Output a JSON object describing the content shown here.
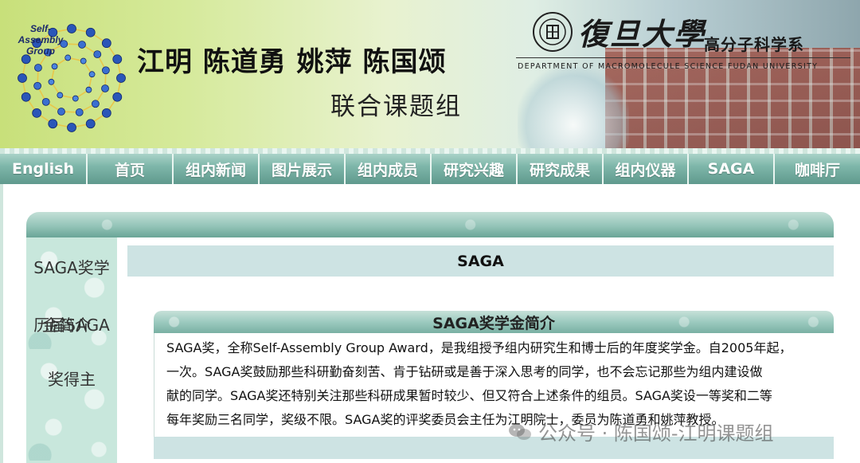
{
  "banner": {
    "logo_text": "Self-\nAssembly\nGroup",
    "names": "江明  陈道勇  姚萍  陈国颂",
    "group_label": "联合课题组",
    "university": "復旦大學",
    "department": "高分子科学系",
    "department_en": "DEPARTMENT OF MACROMOLECULE SCIENCE FUDAN UNIVERSITY"
  },
  "nav": {
    "items": [
      {
        "label": "English"
      },
      {
        "label": "首页"
      },
      {
        "label": "组内新闻"
      },
      {
        "label": "图片展示"
      },
      {
        "label": "组内成员"
      },
      {
        "label": "研究兴趣"
      },
      {
        "label": "研究成果"
      },
      {
        "label": "组内仪器"
      },
      {
        "label": "SAGA"
      },
      {
        "label": "咖啡厅"
      }
    ]
  },
  "sidebar": {
    "item_scholarship": "SAGA奖学",
    "item_history_a": "历届SAGA",
    "item_history_b": "金简介",
    "item_winners": "奖得主"
  },
  "main": {
    "header": "SAGA",
    "section_title": "SAGA奖学金简介",
    "paragraph_lines": [
      "SAGA奖，全称Self-Assembly Group Award，是我组授予组内研究生和博士后的年度奖学金。自2005年起，",
      "一次。SAGA奖鼓励那些科研勤奋刻苦、肯于钻研或是善于深入思考的同学，也不会忘记那些为组内建设做",
      "献的同学。SAGA奖还特别关注那些科研成果暂时较少、但又符合上述条件的组员。SAGA奖设一等奖和二等",
      "每年奖励三名同学，奖级不限。SAGA奖的评奖委员会主任为江明院士，委员为陈道勇和姚萍教授。"
    ]
  },
  "watermark": {
    "text": "公众号 · 陈国颂-江明课题组"
  },
  "colors": {
    "nav_teal": "#7fb7aa",
    "header_band": "#cde3e3",
    "sidebar_mint": "#c8e7dc"
  }
}
